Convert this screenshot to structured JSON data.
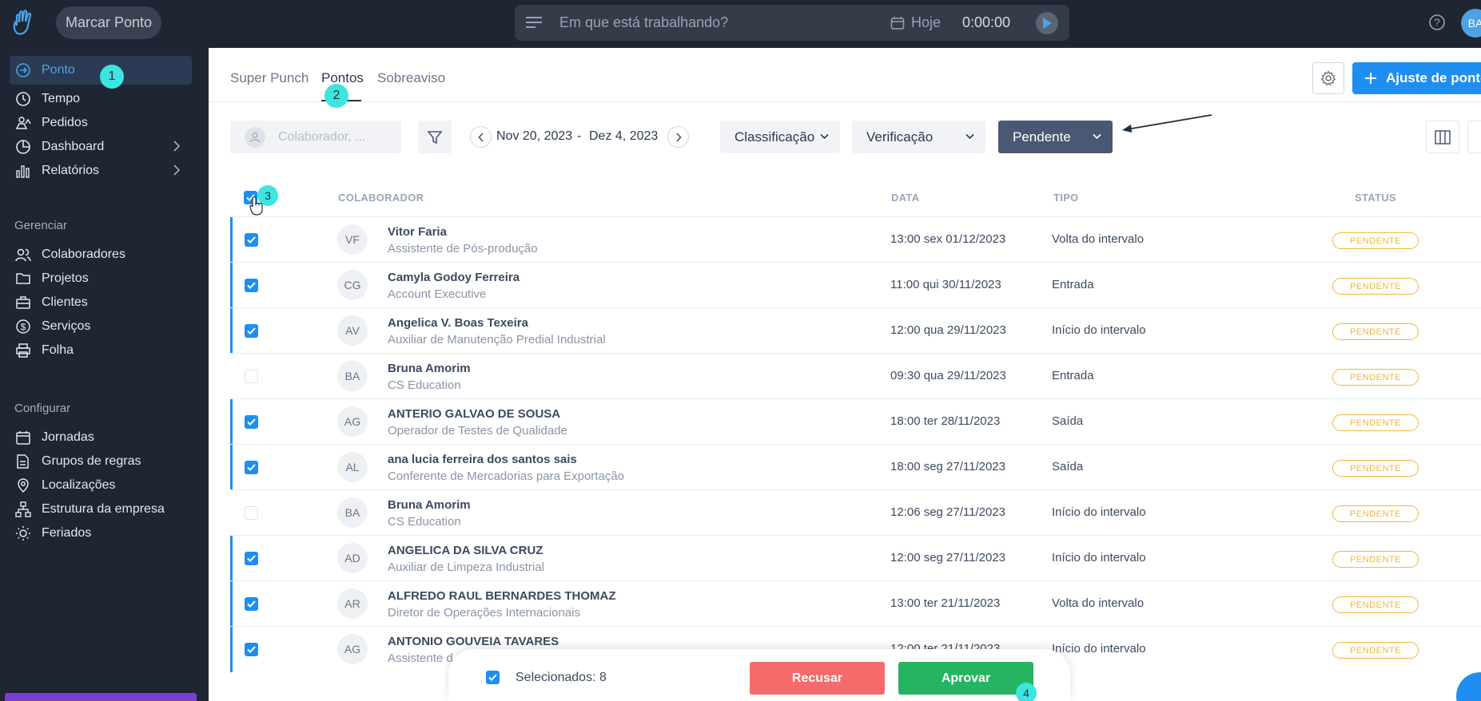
{
  "topbar": {
    "marcar_ponto": "Marcar Ponto",
    "task_placeholder": "Em que está trabalhando?",
    "date_label": "Hoje",
    "timer": "0:00:00",
    "avatar_initials": "BA"
  },
  "sidebar": {
    "items": [
      {
        "label": "Ponto",
        "icon": "arrow-in-icon"
      },
      {
        "label": "Tempo",
        "icon": "clock-icon"
      },
      {
        "label": "Pedidos",
        "icon": "people-icon"
      },
      {
        "label": "Dashboard",
        "icon": "pie-icon"
      },
      {
        "label": "Relatórios",
        "icon": "bar-chart-icon"
      }
    ],
    "section_manage": "Gerenciar",
    "manage_items": [
      {
        "label": "Colaboradores",
        "icon": "users-icon"
      },
      {
        "label": "Projetos",
        "icon": "folder-icon"
      },
      {
        "label": "Clientes",
        "icon": "briefcase-icon"
      },
      {
        "label": "Serviços",
        "icon": "dollar-icon"
      },
      {
        "label": "Folha",
        "icon": "printer-icon"
      }
    ],
    "section_config": "Configurar",
    "config_items": [
      {
        "label": "Jornadas",
        "icon": "calendar-icon"
      },
      {
        "label": "Grupos de regras",
        "icon": "rules-icon"
      },
      {
        "label": "Localizações",
        "icon": "location-icon"
      },
      {
        "label": "Estrutura da empresa",
        "icon": "org-icon"
      },
      {
        "label": "Feriados",
        "icon": "sun-icon"
      }
    ]
  },
  "tabs": [
    "Super Punch",
    "Pontos",
    "Sobreaviso"
  ],
  "ajuste_button": "Ajuste de ponto",
  "filters": {
    "collaborator_placeholder": "Colaborador, ...",
    "date_start": "Nov 20, 2023",
    "date_sep": "-",
    "date_end": "Dez 4, 2023",
    "classification": "Classificação",
    "verification": "Verificação",
    "status": "Pendente"
  },
  "table": {
    "headers": [
      "COLABORADOR",
      "DATA",
      "TIPO",
      "STATUS"
    ],
    "rows": [
      {
        "initials": "VF",
        "name": "Vitor Faria",
        "role": "Assistente de Pós-produção",
        "date": "13:00 sex 01/12/2023",
        "tipo": "Volta do intervalo",
        "status": "PENDENTE",
        "selected": true
      },
      {
        "initials": "CG",
        "name": "Camyla Godoy Ferreira",
        "role": "Account Executive",
        "date": "11:00 qui 30/11/2023",
        "tipo": "Entrada",
        "status": "PENDENTE",
        "selected": true
      },
      {
        "initials": "AV",
        "name": "Angelica V. Boas Texeira",
        "role": "Auxiliar de Manutenção Predial Industrial",
        "date": "12:00 qua 29/11/2023",
        "tipo": "Início do intervalo",
        "status": "PENDENTE",
        "selected": true
      },
      {
        "initials": "BA",
        "name": "Bruna Amorim",
        "role": "CS Education",
        "date": "09:30 qua 29/11/2023",
        "tipo": "Entrada",
        "status": "PENDENTE",
        "selected": false
      },
      {
        "initials": "AG",
        "name": "ANTERIO GALVAO DE SOUSA",
        "role": "Operador de Testes de Qualidade",
        "date": "18:00 ter 28/11/2023",
        "tipo": "Saída",
        "status": "PENDENTE",
        "selected": true
      },
      {
        "initials": "AL",
        "name": "ana lucia ferreira dos santos sais",
        "role": "Conferente de Mercadorias para Exportação",
        "date": "18:00 seg 27/11/2023",
        "tipo": "Saída",
        "status": "PENDENTE",
        "selected": true
      },
      {
        "initials": "BA",
        "name": "Bruna Amorim",
        "role": "CS Education",
        "date": "12:06 seg 27/11/2023",
        "tipo": "Início do intervalo",
        "status": "PENDENTE",
        "selected": false
      },
      {
        "initials": "AD",
        "name": "ANGELICA DA SILVA CRUZ",
        "role": "Auxiliar de Limpeza Industrial",
        "date": "12:00 seg 27/11/2023",
        "tipo": "Início do intervalo",
        "status": "PENDENTE",
        "selected": true
      },
      {
        "initials": "AR",
        "name": "ALFREDO RAUL BERNARDES THOMAZ",
        "role": "Diretor de Operações Internacionais",
        "date": "13:00 ter 21/11/2023",
        "tipo": "Volta do intervalo",
        "status": "PENDENTE",
        "selected": true
      },
      {
        "initials": "AG",
        "name": "ANTONIO GOUVEIA TAVARES",
        "role": "Assistente d",
        "date": "12:00 ter 21/11/2023",
        "tipo": "Início do intervalo",
        "status": "PENDENTE",
        "selected": true
      }
    ]
  },
  "bottom_bar": {
    "selected_text": "Selecionados: 8",
    "reject": "Recusar",
    "approve": "Aprovar"
  },
  "steps": [
    "1",
    "2",
    "3",
    "4"
  ],
  "colors": {
    "sidebar_bg": "#1e2533",
    "accent": "#1e8ff0",
    "pending": "#f3b73a",
    "reject": "#f56a6a",
    "approve": "#26b462",
    "step_marker": "#3ee5e0"
  }
}
